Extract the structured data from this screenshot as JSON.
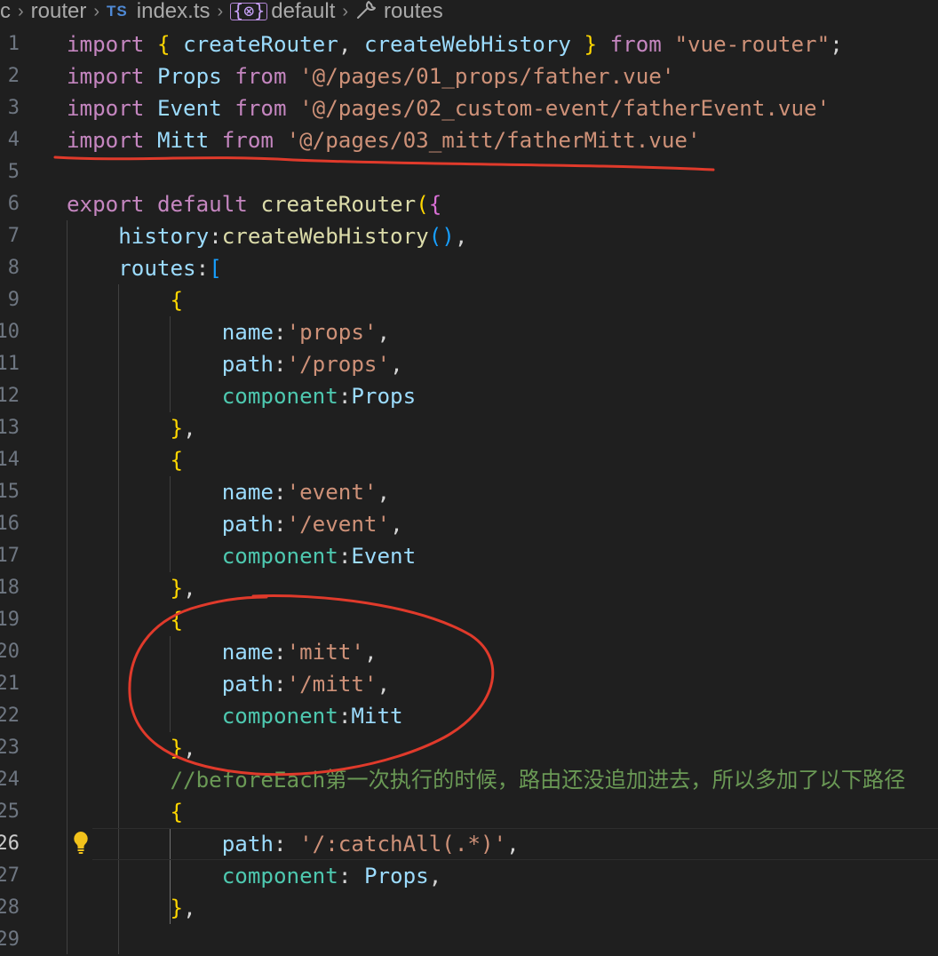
{
  "breadcrumb": {
    "items": [
      "c",
      "router",
      "index.ts",
      "default",
      "routes"
    ],
    "ts_badge": "TS",
    "brace_icon": "{⊗}"
  },
  "code": {
    "lines": [
      {
        "n": "1",
        "t": [
          [
            "imp",
            "import"
          ],
          [
            "pun",
            " "
          ],
          [
            "br1",
            "{"
          ],
          [
            "pun",
            " "
          ],
          [
            "id",
            "createRouter"
          ],
          [
            "pun",
            ", "
          ],
          [
            "id",
            "createWebHistory"
          ],
          [
            "pun",
            " "
          ],
          [
            "br1",
            "}"
          ],
          [
            "pun",
            " "
          ],
          [
            "imp",
            "from"
          ],
          [
            "pun",
            " "
          ],
          [
            "str",
            "\"vue-router\""
          ],
          [
            "pun",
            ";"
          ]
        ]
      },
      {
        "n": "2",
        "t": [
          [
            "imp",
            "import"
          ],
          [
            "pun",
            " "
          ],
          [
            "id",
            "Props"
          ],
          [
            "pun",
            " "
          ],
          [
            "imp",
            "from"
          ],
          [
            "pun",
            " "
          ],
          [
            "str",
            "'@/pages/01_props/father.vue'"
          ]
        ]
      },
      {
        "n": "3",
        "t": [
          [
            "imp",
            "import"
          ],
          [
            "pun",
            " "
          ],
          [
            "id",
            "Event"
          ],
          [
            "pun",
            " "
          ],
          [
            "imp",
            "from"
          ],
          [
            "pun",
            " "
          ],
          [
            "str",
            "'@/pages/02_custom-event/fatherEvent.vue'"
          ]
        ]
      },
      {
        "n": "4",
        "t": [
          [
            "imp",
            "import"
          ],
          [
            "pun",
            " "
          ],
          [
            "id",
            "Mitt"
          ],
          [
            "pun",
            " "
          ],
          [
            "imp",
            "from"
          ],
          [
            "pun",
            " "
          ],
          [
            "str",
            "'@/pages/03_mitt/fatherMitt.vue'"
          ]
        ]
      },
      {
        "n": "5",
        "t": []
      },
      {
        "n": "6",
        "t": [
          [
            "kw",
            "export"
          ],
          [
            "pun",
            " "
          ],
          [
            "kw",
            "default"
          ],
          [
            "pun",
            " "
          ],
          [
            "fn",
            "createRouter"
          ],
          [
            "br1",
            "("
          ],
          [
            "br2",
            "{"
          ]
        ]
      },
      {
        "n": "7",
        "t": [
          [
            "pun",
            "    "
          ],
          [
            "prop",
            "history"
          ],
          [
            "pun",
            ":"
          ],
          [
            "fn",
            "createWebHistory"
          ],
          [
            "br3",
            "()"
          ],
          [
            "pun",
            ","
          ]
        ]
      },
      {
        "n": "8",
        "t": [
          [
            "pun",
            "    "
          ],
          [
            "prop",
            "routes"
          ],
          [
            "pun",
            ":"
          ],
          [
            "br3",
            "["
          ]
        ]
      },
      {
        "n": "9",
        "t": [
          [
            "pun",
            "        "
          ],
          [
            "br1",
            "{"
          ]
        ]
      },
      {
        "n": "10",
        "t": [
          [
            "pun",
            "            "
          ],
          [
            "prop",
            "name"
          ],
          [
            "pun",
            ":"
          ],
          [
            "str",
            "'props'"
          ],
          [
            "pun",
            ","
          ]
        ]
      },
      {
        "n": "11",
        "t": [
          [
            "pun",
            "            "
          ],
          [
            "prop",
            "path"
          ],
          [
            "pun",
            ":"
          ],
          [
            "str",
            "'/props'"
          ],
          [
            "pun",
            ","
          ]
        ]
      },
      {
        "n": "12",
        "t": [
          [
            "pun",
            "            "
          ],
          [
            "cls",
            "component"
          ],
          [
            "pun",
            ":"
          ],
          [
            "id",
            "Props"
          ]
        ]
      },
      {
        "n": "13",
        "t": [
          [
            "pun",
            "        "
          ],
          [
            "br1",
            "}"
          ],
          [
            "pun",
            ","
          ]
        ]
      },
      {
        "n": "14",
        "t": [
          [
            "pun",
            "        "
          ],
          [
            "br1",
            "{"
          ]
        ]
      },
      {
        "n": "15",
        "t": [
          [
            "pun",
            "            "
          ],
          [
            "prop",
            "name"
          ],
          [
            "pun",
            ":"
          ],
          [
            "str",
            "'event'"
          ],
          [
            "pun",
            ","
          ]
        ]
      },
      {
        "n": "16",
        "t": [
          [
            "pun",
            "            "
          ],
          [
            "prop",
            "path"
          ],
          [
            "pun",
            ":"
          ],
          [
            "str",
            "'/event'"
          ],
          [
            "pun",
            ","
          ]
        ]
      },
      {
        "n": "17",
        "t": [
          [
            "pun",
            "            "
          ],
          [
            "cls",
            "component"
          ],
          [
            "pun",
            ":"
          ],
          [
            "id",
            "Event"
          ]
        ]
      },
      {
        "n": "18",
        "t": [
          [
            "pun",
            "        "
          ],
          [
            "br1",
            "}"
          ],
          [
            "pun",
            ","
          ]
        ]
      },
      {
        "n": "19",
        "t": [
          [
            "pun",
            "        "
          ],
          [
            "br1",
            "{"
          ]
        ]
      },
      {
        "n": "20",
        "t": [
          [
            "pun",
            "            "
          ],
          [
            "prop",
            "name"
          ],
          [
            "pun",
            ":"
          ],
          [
            "str",
            "'mitt'"
          ],
          [
            "pun",
            ","
          ]
        ]
      },
      {
        "n": "21",
        "t": [
          [
            "pun",
            "            "
          ],
          [
            "prop",
            "path"
          ],
          [
            "pun",
            ":"
          ],
          [
            "str",
            "'/mitt'"
          ],
          [
            "pun",
            ","
          ]
        ]
      },
      {
        "n": "22",
        "t": [
          [
            "pun",
            "            "
          ],
          [
            "cls",
            "component"
          ],
          [
            "pun",
            ":"
          ],
          [
            "id",
            "Mitt"
          ]
        ]
      },
      {
        "n": "23",
        "t": [
          [
            "pun",
            "        "
          ],
          [
            "br1",
            "}"
          ],
          [
            "pun",
            ","
          ]
        ]
      },
      {
        "n": "24",
        "t": [
          [
            "pun",
            "        "
          ],
          [
            "cmt",
            "//beforeEach第一次执行的时候，路由还没追加进去，所以多加了以下路径"
          ]
        ]
      },
      {
        "n": "25",
        "t": [
          [
            "pun",
            "        "
          ],
          [
            "br1",
            "{"
          ]
        ]
      },
      {
        "n": "26",
        "t": [
          [
            "pun",
            "            "
          ],
          [
            "prop",
            "path"
          ],
          [
            "pun",
            ": "
          ],
          [
            "str",
            "'/:catchAll(.*)'"
          ],
          [
            "pun",
            ","
          ]
        ]
      },
      {
        "n": "27",
        "t": [
          [
            "pun",
            "            "
          ],
          [
            "cls",
            "component"
          ],
          [
            "pun",
            ": "
          ],
          [
            "id",
            "Props"
          ],
          [
            "pun",
            ","
          ]
        ]
      },
      {
        "n": "28",
        "t": [
          [
            "pun",
            "        "
          ],
          [
            "br1",
            "}"
          ],
          [
            "pun",
            ","
          ]
        ]
      },
      {
        "n": "29",
        "t": []
      }
    ],
    "active_line": "26"
  },
  "annotations": {
    "underline_color": "#e03a2b",
    "circle_color": "#e03a2b"
  }
}
